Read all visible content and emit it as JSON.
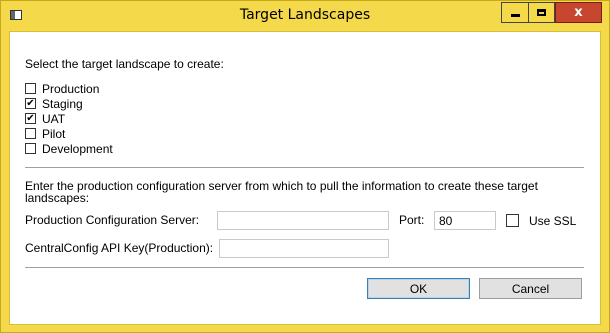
{
  "window": {
    "title": "Target Landscapes",
    "close_glyph": "x",
    "colors": {
      "frame": "#f4d94a",
      "close_button": "#c7462f"
    },
    "icons": {
      "app": "window-icon",
      "minimize": "minimize-icon",
      "maximize": "maximize-icon",
      "close": "close-icon"
    }
  },
  "landscape": {
    "prompt": "Select the target landscape to create:",
    "options": [
      {
        "label": "Production",
        "checked": false
      },
      {
        "label": "Staging",
        "checked": true
      },
      {
        "label": "UAT",
        "checked": true
      },
      {
        "label": "Pilot",
        "checked": false
      },
      {
        "label": "Development",
        "checked": false
      }
    ]
  },
  "config": {
    "description": "Enter the production configuration server from which to pull the information to create these target landscapes:",
    "server_label": "Production Configuration Server:",
    "server_value": "",
    "port_label": "Port:",
    "port_value": "80",
    "ssl_label": "Use SSL",
    "ssl_checked": false,
    "apikey_label": "CentralConfig API Key(Production):",
    "apikey_value": ""
  },
  "buttons": {
    "ok": "OK",
    "cancel": "Cancel"
  }
}
